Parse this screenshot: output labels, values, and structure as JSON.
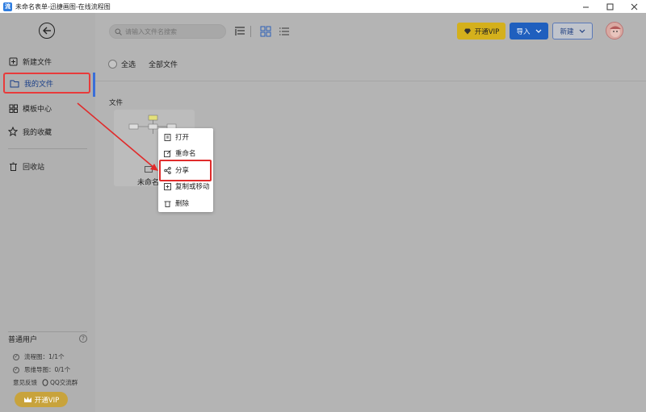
{
  "window": {
    "title": "未命名表单-迅捷画图-在线流程图",
    "app_icon_text": "流",
    "controls": [
      "minimize",
      "maximize",
      "close"
    ]
  },
  "sidebar": {
    "items": [
      {
        "label": "新建文件",
        "icon": "new-file-icon"
      },
      {
        "label": "我的文件",
        "icon": "folder-icon",
        "active": true
      },
      {
        "label": "模板中心",
        "icon": "grid-icon"
      },
      {
        "label": "我的收藏",
        "icon": "star-icon"
      },
      {
        "label": "回收站",
        "icon": "trash-icon"
      }
    ],
    "user_type": "普通用户",
    "quotas": [
      {
        "label": "流程图：1/1个"
      },
      {
        "label": "思维导图：0/1个"
      }
    ],
    "feedback": "意见反馈",
    "qq_group": "QQ交流群",
    "vip_button": "开通VIP"
  },
  "toolbar": {
    "search_placeholder": "请输入文件名搜索",
    "vip_button": "开通VIP",
    "import_button": "导入",
    "new_button": "新建"
  },
  "main": {
    "select_all": "全选",
    "all_files": "全部文件",
    "section_label": "文件",
    "file_name": "未命名"
  },
  "context_menu": {
    "items": [
      {
        "label": "打开",
        "icon": "open-icon"
      },
      {
        "label": "重命名",
        "icon": "rename-icon"
      },
      {
        "label": "分享",
        "icon": "share-icon",
        "highlighted": true
      },
      {
        "label": "复制或移动",
        "icon": "copy-move-icon"
      },
      {
        "label": "删除",
        "icon": "delete-icon"
      }
    ]
  },
  "colors": {
    "highlight_red": "#e02b2b",
    "primary_blue": "#1f5fbe",
    "vip_gold": "#d4b01c"
  }
}
